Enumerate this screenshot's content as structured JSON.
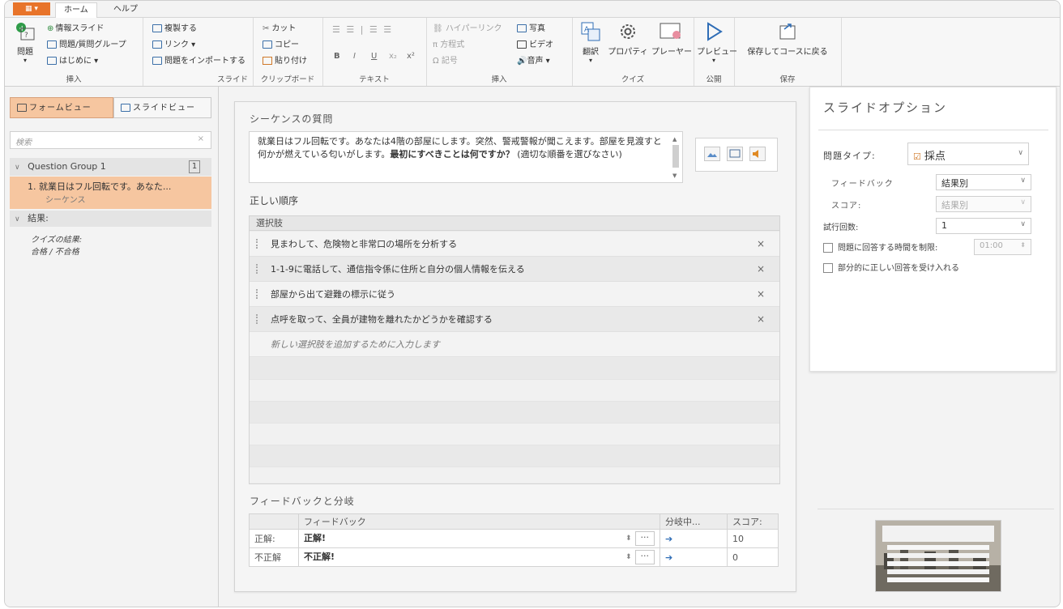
{
  "tabs": {
    "app_button": "▦ ▾",
    "home": "ホーム",
    "help": "ヘルプ"
  },
  "ribbon": {
    "insert": {
      "label": "挿入",
      "question": "問題",
      "info_slide": "情報スライド",
      "question_group": "問題/質問グループ",
      "intro": "はじめに ▾"
    },
    "slide": {
      "label": "スライド",
      "duplicate": "複製する",
      "link": "リンク ▾",
      "import": "問題をインポートする"
    },
    "clipboard": {
      "label": "クリップボード",
      "cut": "カット",
      "copy": "コピー",
      "paste": "貼り付け"
    },
    "text": {
      "label": "テキスト",
      "bold": "B",
      "italic": "I",
      "underline": "U",
      "subscript": "x₂",
      "superscript": "x²"
    },
    "insert2": {
      "label": "挿入",
      "hyperlink": "ハイパーリンク",
      "equation": "方程式",
      "symbol": "記号",
      "photo": "写真",
      "video": "ビデオ",
      "audio": "音声 ▾"
    },
    "quiz": {
      "label": "クイズ",
      "translate": "翻訳",
      "properties": "プロパティ",
      "player": "プレーヤー"
    },
    "publish": {
      "label": "公開",
      "preview": "プレビュー"
    },
    "save": {
      "label": "保存",
      "save_return": "保存してコースに戻る"
    }
  },
  "left": {
    "form_view": "フォームビュー",
    "slide_view": "スライドビュー",
    "search_placeholder": "検索",
    "group_name": "Question Group 1",
    "group_count": "1",
    "item_title": "1. 就業日はフル回転です。あなた...",
    "item_type": "シーケンス",
    "results_header": "結果:",
    "results_title": "クイズの結果:",
    "results_sub": "合格 / 不合格"
  },
  "center": {
    "question_header": "シーケンスの質問",
    "question_text_1": "就業日はフル回転です。あなたは4階の部屋にします。突然、警戒警報が聞こえま",
    "question_text_2": "す。部屋を見渡すと何かが燃えている匂いがします。",
    "question_bold_1": "最初にすべきことは何です",
    "question_bold_2": "か？",
    "question_text_3": "(適切な順番を選びなさい)",
    "order_header": "正しい順序",
    "choices_header": "選択肢",
    "choices": [
      "見まわして、危険物と非常口の場所を分析する",
      "1-1-9に電話して、通信指令係に住所と自分の個人情報を伝える",
      "部屋から出て避難の標示に従う",
      "点呼を取って、全員が建物を離れたかどうかを確認する"
    ],
    "add_choice": "新しい選択肢を追加するために入力します",
    "feedback_header": "フィードバックと分岐",
    "fb_col_feedback": "フィードバック",
    "fb_col_branch": "分岐中...",
    "fb_col_score": "スコア:",
    "rows": [
      {
        "label": "正解:",
        "feedback": "正解!",
        "score": "10"
      },
      {
        "label": "不正解",
        "feedback": "不正解!",
        "score": "0"
      }
    ]
  },
  "right": {
    "title": "スライドオプション",
    "question_type_label": "問題タイプ:",
    "question_type_value": "採点",
    "feedback_label": "フィードバック",
    "feedback_value": "結果別",
    "score_label": "スコア:",
    "score_value": "結果別",
    "attempts_label": "試行回数:",
    "attempts_value": "1",
    "time_limit_label": "問題に回答する時間を制限:",
    "time_limit_value": "01:00",
    "partial_label": "部分的に正しい回答を受け入れる"
  }
}
